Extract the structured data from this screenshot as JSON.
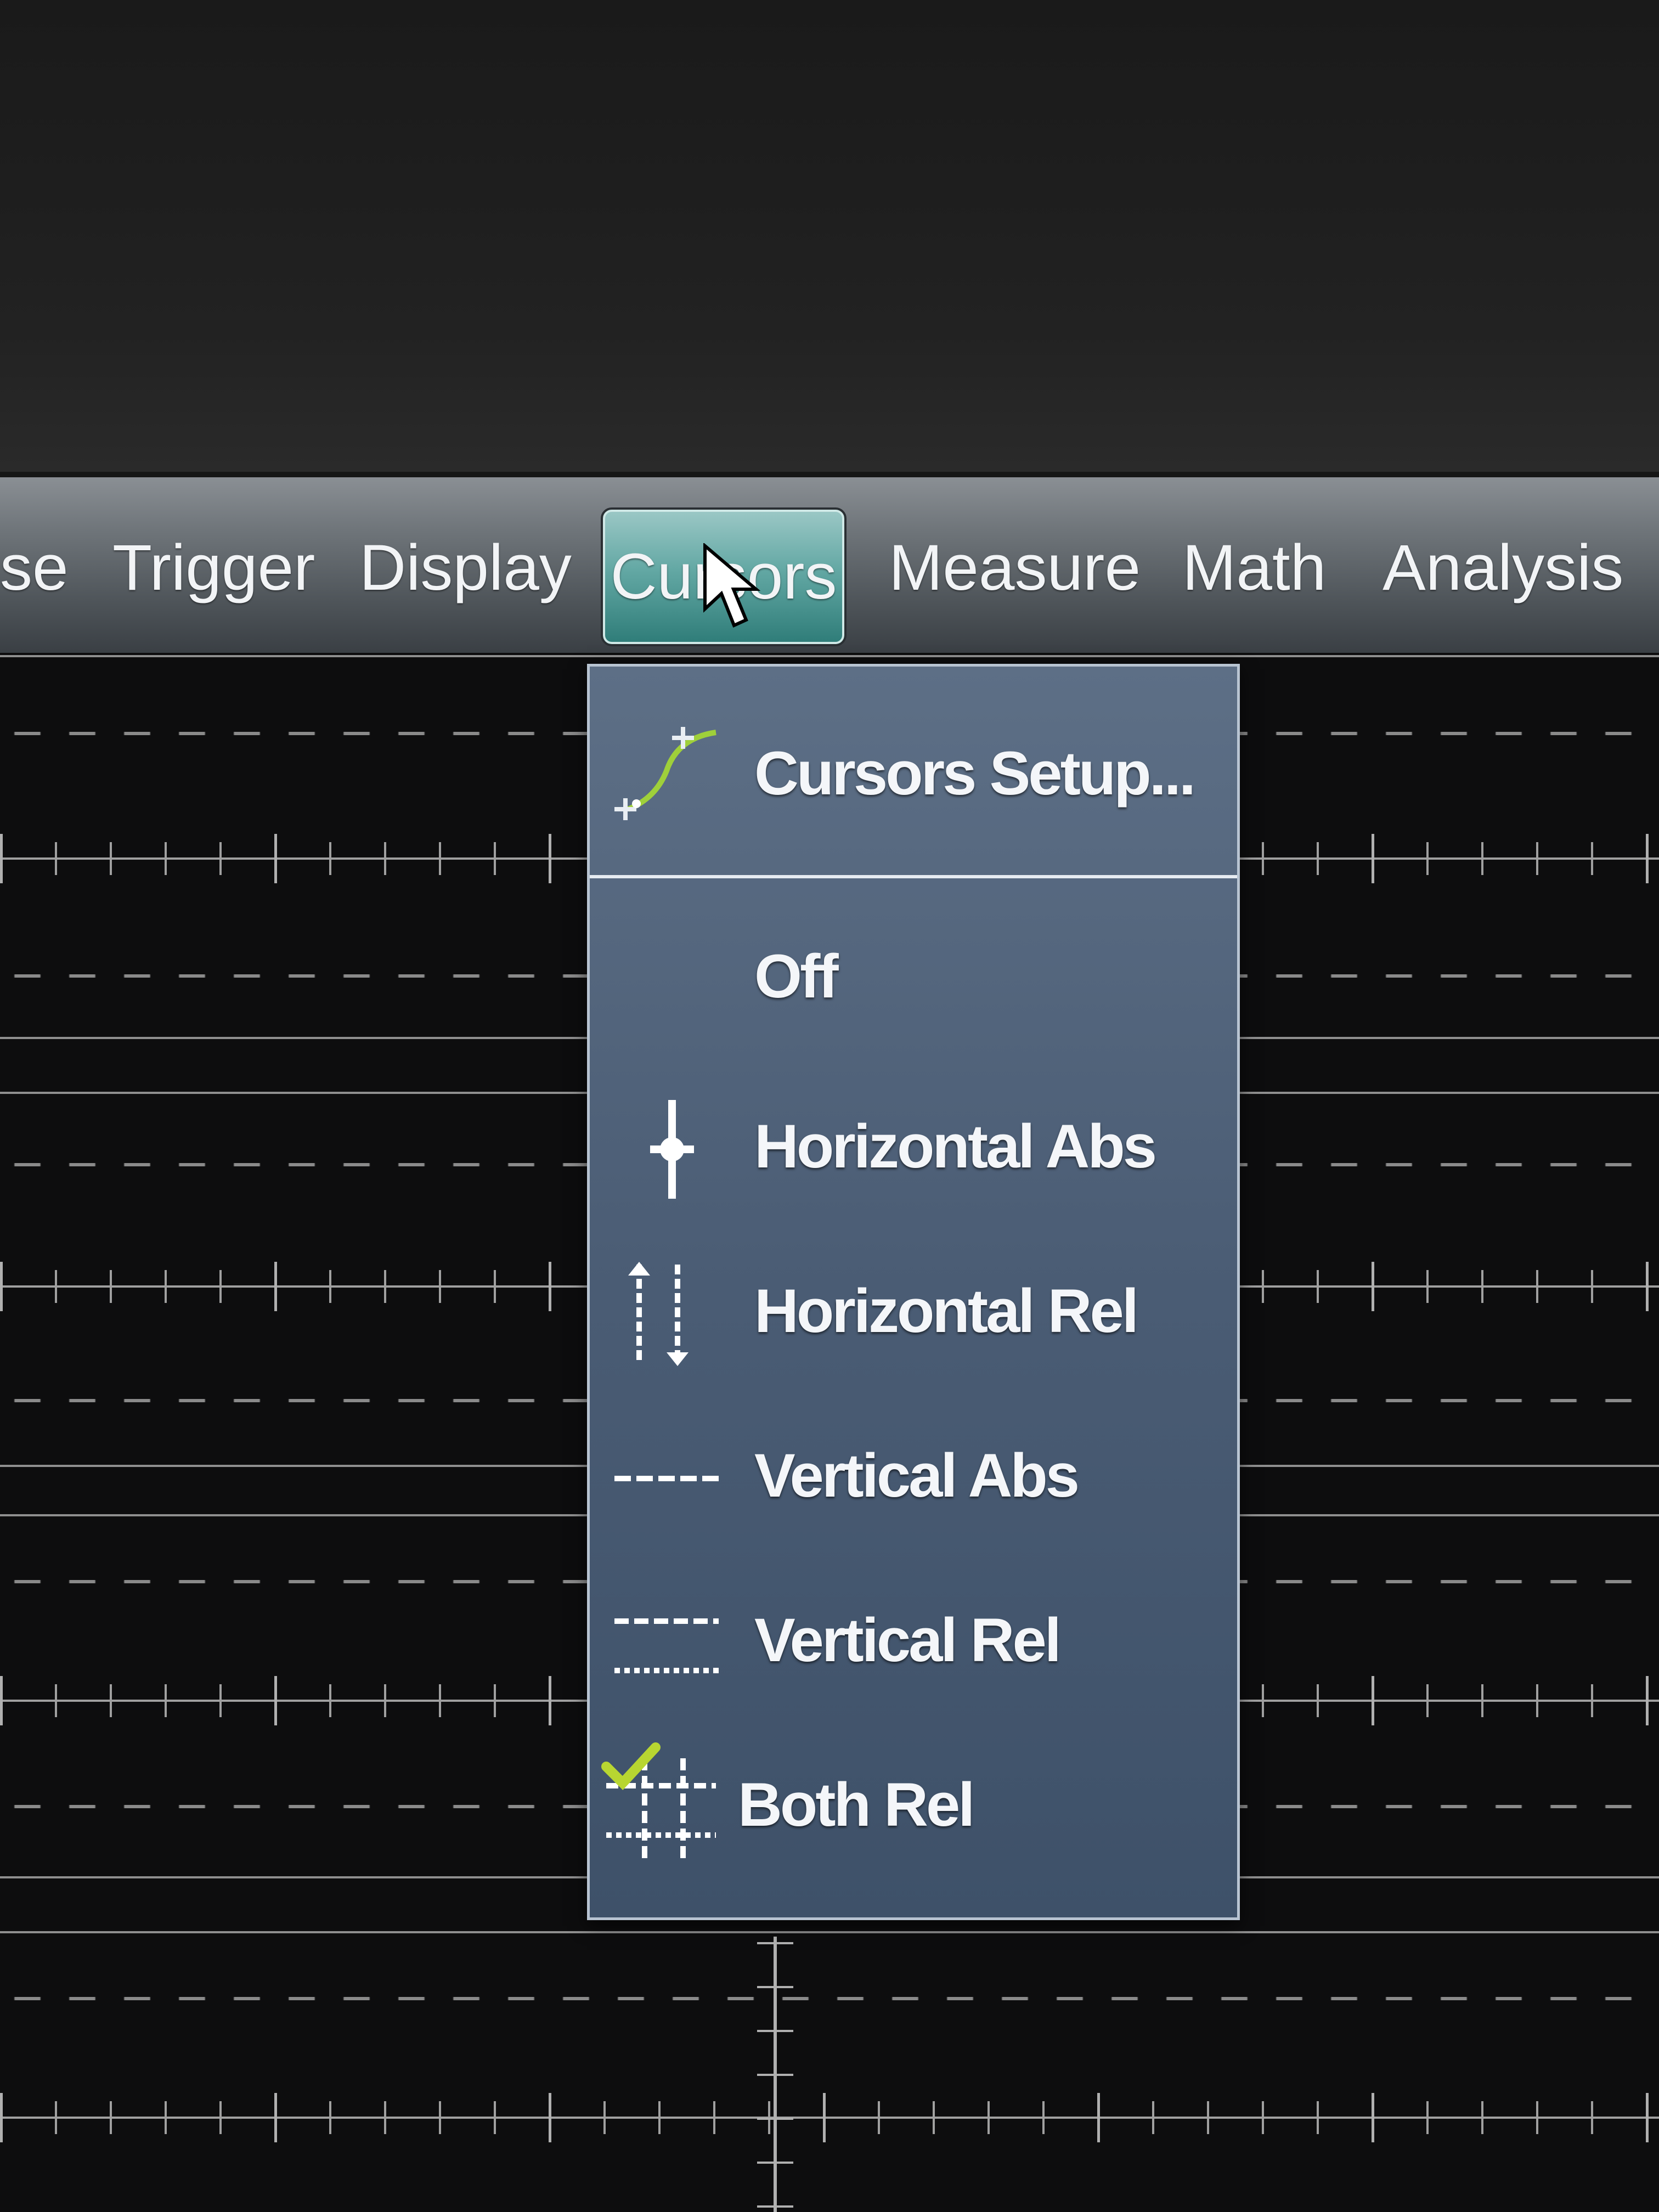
{
  "menubar": {
    "items": [
      {
        "label": "se"
      },
      {
        "label": "Trigger"
      },
      {
        "label": "Display"
      },
      {
        "label": "Cursors",
        "active": true
      },
      {
        "label": "Measure"
      },
      {
        "label": "Math"
      },
      {
        "label": "Analysis"
      }
    ]
  },
  "cursors_menu": {
    "items": [
      {
        "label": "Cursors Setup...",
        "icon": "cursors-setup-icon"
      },
      {
        "label": "Off",
        "icon": ""
      },
      {
        "label": "Horizontal Abs",
        "icon": "horizontal-abs-icon"
      },
      {
        "label": "Horizontal Rel",
        "icon": "horizontal-rel-icon"
      },
      {
        "label": "Vertical Abs",
        "icon": "vertical-abs-icon"
      },
      {
        "label": "Vertical Rel",
        "icon": "vertical-rel-icon"
      },
      {
        "label": "Both Rel",
        "icon": "both-rel-icon",
        "checked": true
      }
    ]
  },
  "colors": {
    "menu_active": "#63a8a4",
    "dropdown_bg": "#4a5c74",
    "check": "#b8d631"
  }
}
